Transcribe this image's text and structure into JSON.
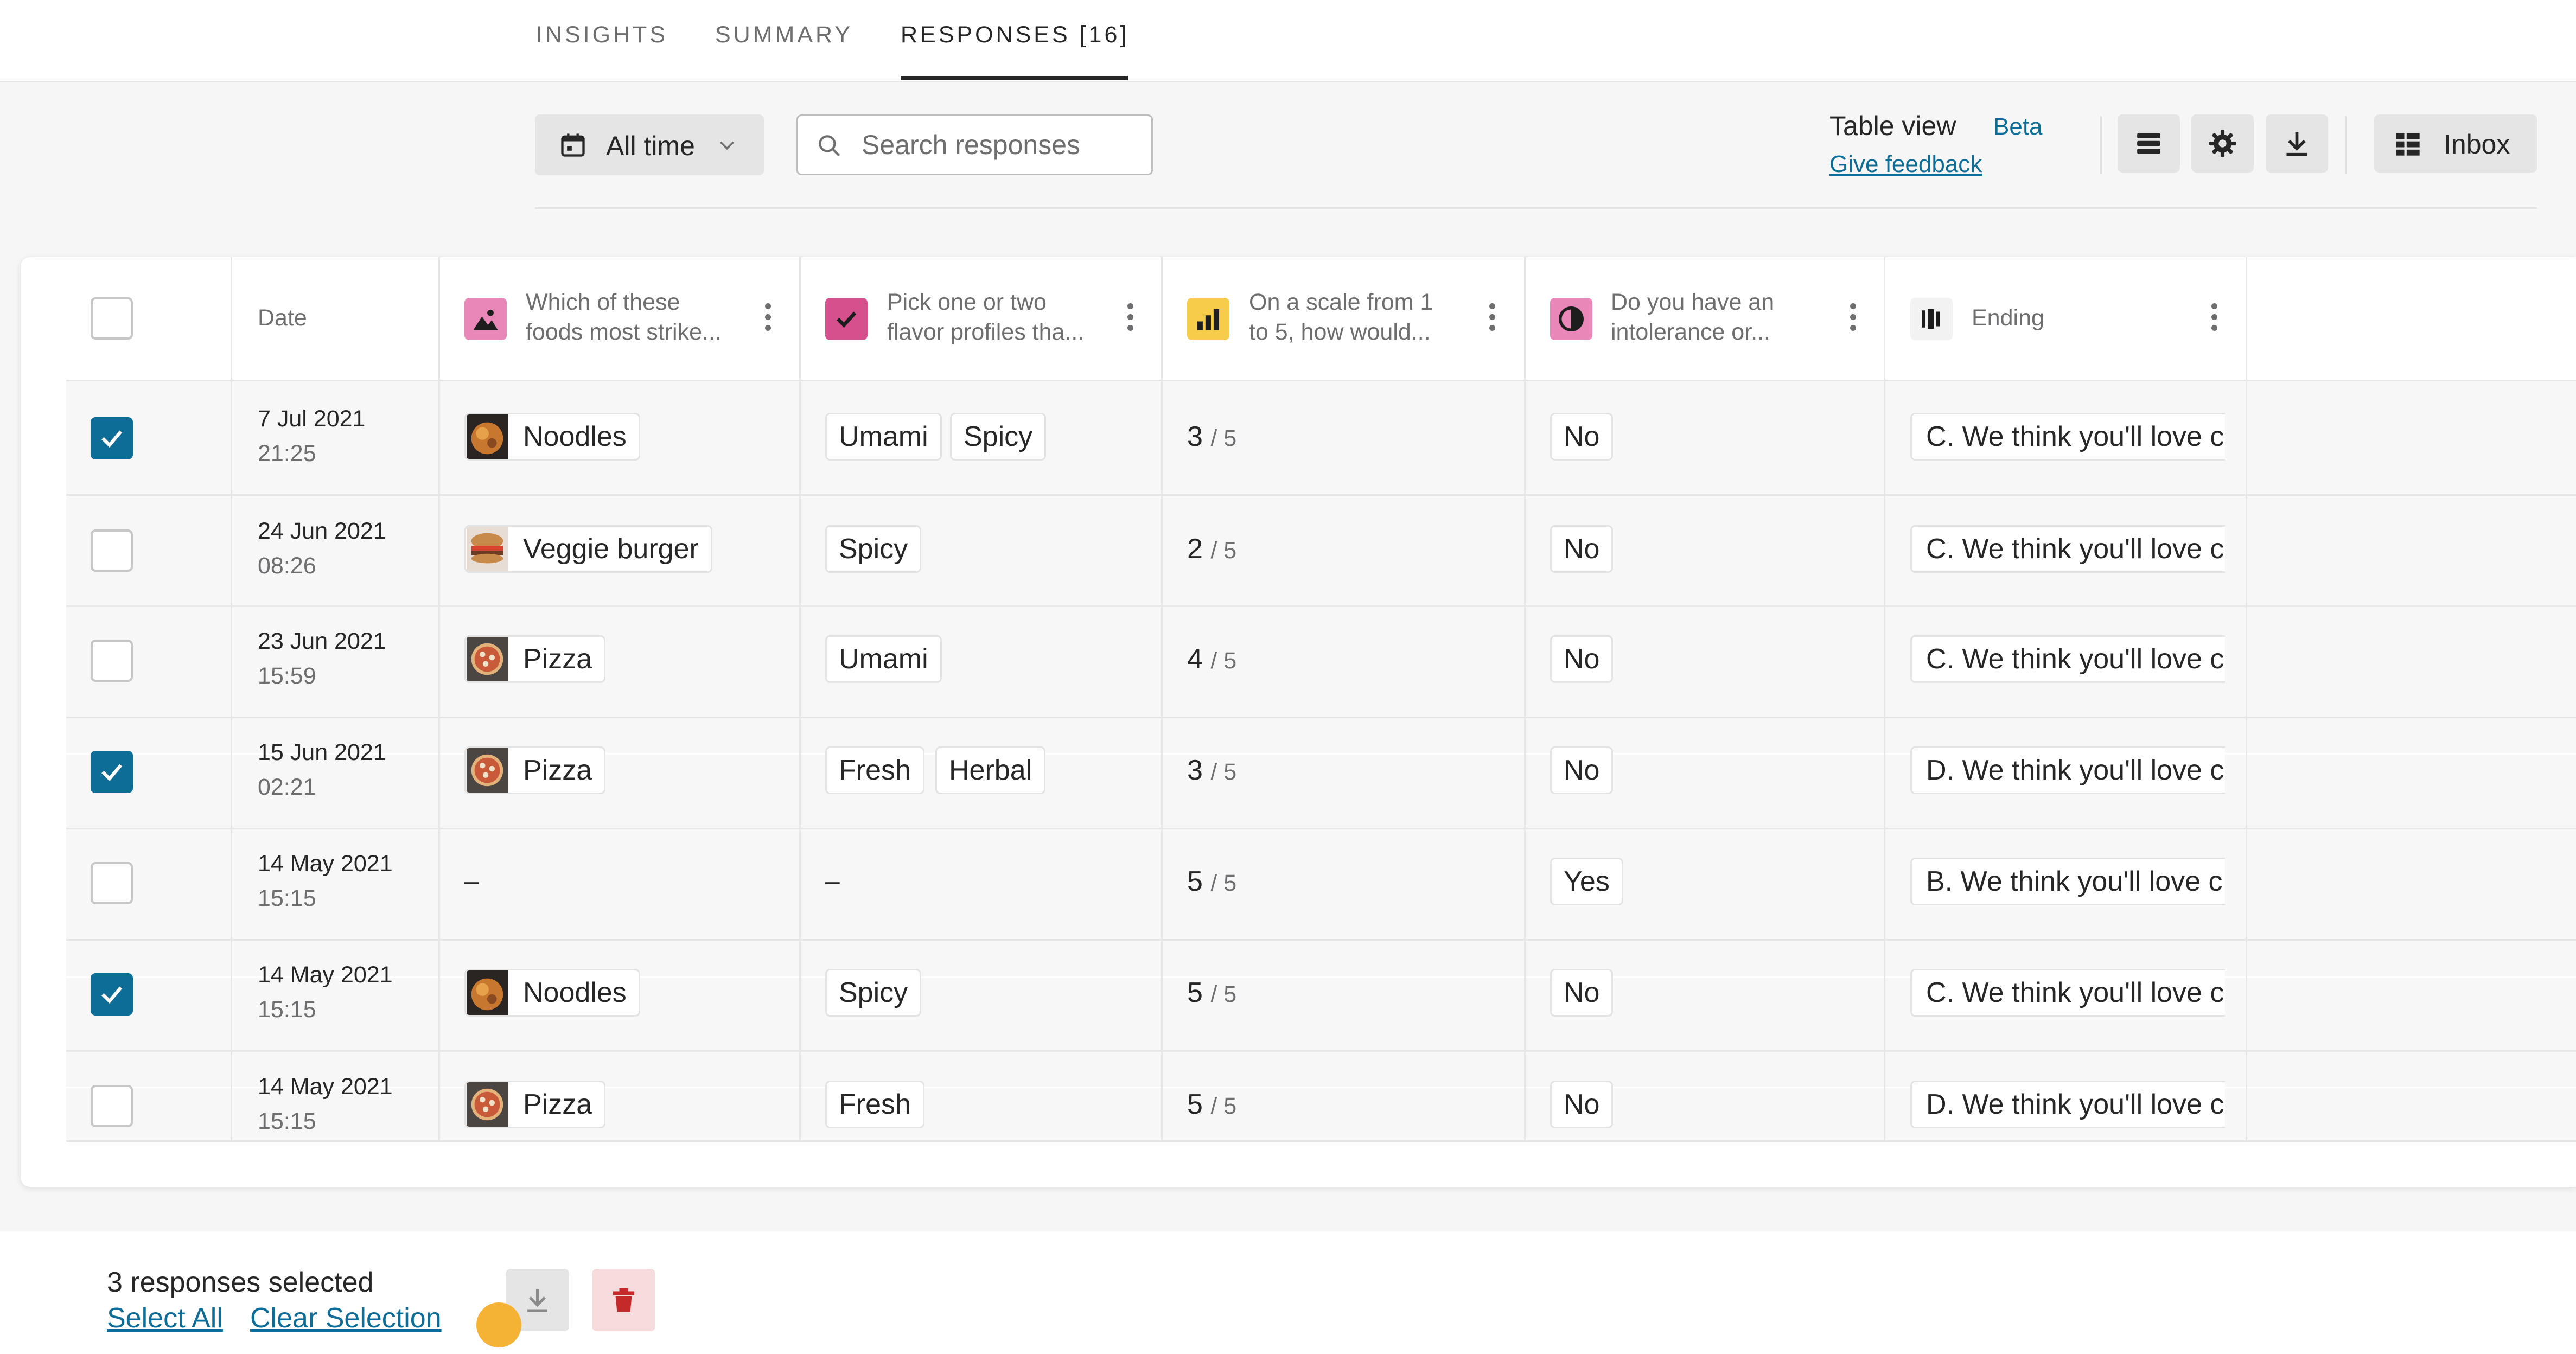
{
  "tabs": [
    {
      "label": "INSIGHTS",
      "active": false
    },
    {
      "label": "SUMMARY",
      "active": false
    },
    {
      "label": "RESPONSES [16]",
      "active": true
    }
  ],
  "toolbar": {
    "date_filter": {
      "label": "All time",
      "icon": "calendar-icon"
    },
    "search": {
      "placeholder": "Search responses",
      "value": "",
      "icon": "search-icon"
    },
    "table_view": {
      "title": "Table view",
      "badge": "Beta",
      "feedback_link": "Give feedback"
    },
    "buttons": [
      {
        "icon": "list-icon"
      },
      {
        "icon": "gear-icon"
      },
      {
        "icon": "download-icon"
      }
    ],
    "inbox": {
      "label": "Inbox",
      "icon": "inbox-grid-icon"
    }
  },
  "table": {
    "columns": [
      {
        "key": "select",
        "label": ""
      },
      {
        "key": "date",
        "label": "Date"
      },
      {
        "key": "food",
        "label": "Which of these foods most strike...",
        "line1": "Which of these",
        "line2": "foods most strike...",
        "icon": "picture-choice-icon",
        "icon_bg": "#e887b8"
      },
      {
        "key": "flavor",
        "label": "Pick one or two flavor profiles tha...",
        "line1": "Pick one or two",
        "line2": "flavor profiles tha...",
        "icon": "multiple-choice-icon",
        "icon_bg": "#d6508d"
      },
      {
        "key": "scale",
        "label": "On a scale from 1 to 5, how would...",
        "line1": "On a scale from 1",
        "line2": "to 5, how would...",
        "icon": "opinion-scale-icon",
        "icon_bg": "#f6cd4a"
      },
      {
        "key": "intolerance",
        "label": "Do you have an intolerance or...",
        "line1": "Do you have an",
        "line2": "intolerance or...",
        "icon": "yes-no-icon",
        "icon_bg": "#e887b8"
      },
      {
        "key": "ending",
        "label": "Ending",
        "icon": "ending-icon",
        "icon_bg": "#f2f2f2"
      }
    ],
    "rows": [
      {
        "selected": true,
        "date": "7 Jul 2021",
        "time": "21:25",
        "food": "Noodles",
        "food_thumb": "noodles-thumb",
        "flavors": [
          "Umami",
          "Spicy"
        ],
        "score": "3",
        "score_max": "/ 5",
        "intolerance": "No",
        "ending": "C. We think you'll love c"
      },
      {
        "selected": false,
        "date": "24 Jun 2021",
        "time": "08:26",
        "food": "Veggie burger",
        "food_thumb": "burger-thumb",
        "flavors": [
          "Spicy"
        ],
        "score": "2",
        "score_max": "/ 5",
        "intolerance": "No",
        "ending": "C. We think you'll love c"
      },
      {
        "selected": false,
        "date": "23 Jun 2021",
        "time": "15:59",
        "food": "Pizza",
        "food_thumb": "pizza-thumb",
        "flavors": [
          "Umami"
        ],
        "score": "4",
        "score_max": "/ 5",
        "intolerance": "No",
        "ending": "C. We think you'll love c"
      },
      {
        "selected": true,
        "date": "15 Jun 2021",
        "time": "02:21",
        "food": "Pizza",
        "food_thumb": "pizza-thumb",
        "flavors": [
          "Fresh",
          "Herbal"
        ],
        "score": "3",
        "score_max": "/ 5",
        "intolerance": "No",
        "ending": "D. We think you'll love c"
      },
      {
        "selected": false,
        "date": "14 May 2021",
        "time": "15:15",
        "food": "–",
        "food_thumb": "",
        "flavors": [],
        "flavor_empty": "–",
        "score": "5",
        "score_max": "/ 5",
        "intolerance": "Yes",
        "ending": "B. We think you'll love c"
      },
      {
        "selected": true,
        "date": "14 May 2021",
        "time": "15:15",
        "food": "Noodles",
        "food_thumb": "noodles-thumb",
        "flavors": [
          "Spicy"
        ],
        "score": "5",
        "score_max": "/ 5",
        "intolerance": "No",
        "ending": "C. We think you'll love c"
      },
      {
        "selected": false,
        "date": "14 May 2021",
        "time": "15:15",
        "food": "Pizza",
        "food_thumb": "pizza-thumb",
        "flavors": [
          "Fresh"
        ],
        "score": "5",
        "score_max": "/ 5",
        "intolerance": "No",
        "ending": "D. We think you'll love c"
      }
    ]
  },
  "selection_bar": {
    "count_text": "3 responses selected",
    "select_all": "Select All",
    "clear_selection": "Clear Selection",
    "download_icon": "download-icon",
    "delete_icon": "trash-icon"
  },
  "colors": {
    "accent": "#0d6d97",
    "delete_bg": "#f6dcdc",
    "delete_icon": "#c42a2a",
    "cursor": "#f5b335"
  }
}
